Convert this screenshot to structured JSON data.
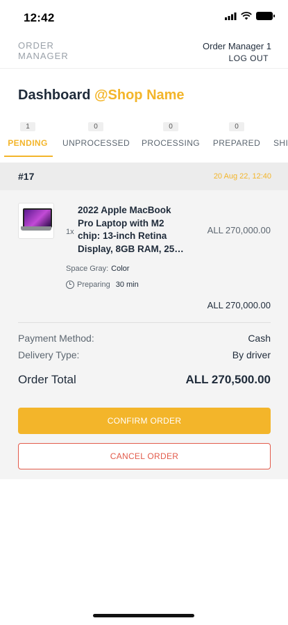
{
  "status_bar": {
    "time": "12:42"
  },
  "header": {
    "brand": "ORDER MANAGER",
    "manager_name": "Order Manager 1",
    "logout_label": "LOG OUT"
  },
  "dashboard": {
    "title": "Dashboard",
    "shop_name": "@Shop Name"
  },
  "tabs": [
    {
      "label": "PENDING",
      "count": "1",
      "active": true
    },
    {
      "label": "UNPROCESSED",
      "count": "0",
      "active": false
    },
    {
      "label": "PROCESSING",
      "count": "0",
      "active": false
    },
    {
      "label": "PREPARED",
      "count": "0",
      "active": false
    },
    {
      "label": "SHI",
      "count": "",
      "active": false
    }
  ],
  "order": {
    "id": "#17",
    "date": "20 Aug 22, 12:40",
    "item": {
      "qty": "1x",
      "name": "2022 Apple MacBook Pro Laptop with M2 chip: 13-inch Retina Display, 8GB RAM, 25…",
      "price": "ALL 270,000.00",
      "variant_label": "Space Gray:",
      "variant_value": "Color",
      "prep_label": "Preparing",
      "prep_value": "30 min"
    },
    "line_total": "ALL 270,000.00",
    "payment_label": "Payment Method:",
    "payment_value": "Cash",
    "delivery_label": "Delivery Type:",
    "delivery_value": "By driver",
    "total_label": "Order Total",
    "total_value": "ALL 270,500.00",
    "confirm_label": "CONFIRM ORDER",
    "cancel_label": "CANCEL ORDER"
  },
  "colors": {
    "accent": "#f3b52a",
    "danger": "#e25a4a",
    "text": "#1f2b3a"
  }
}
